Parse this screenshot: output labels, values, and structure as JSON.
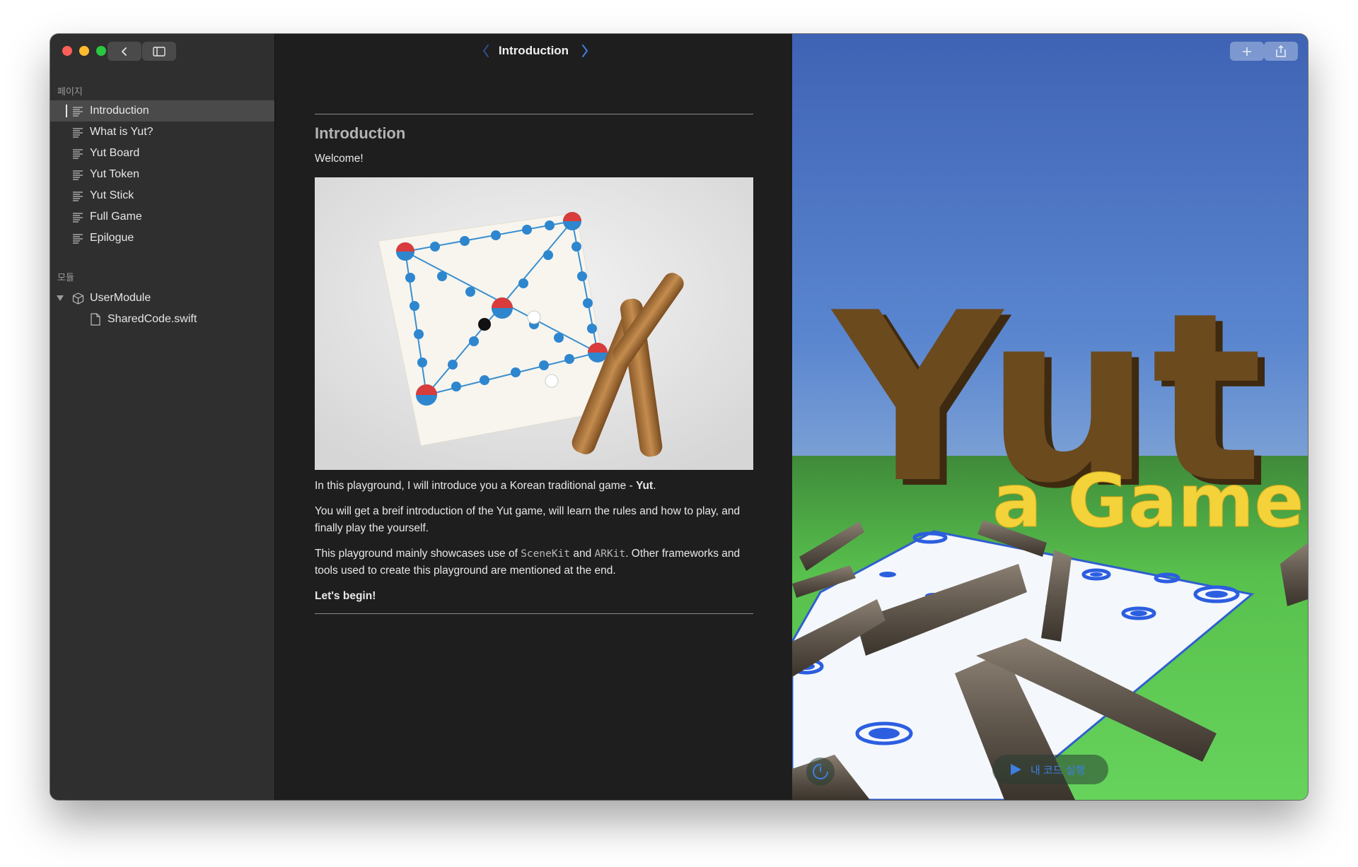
{
  "sidebar": {
    "pages_header": "페이지",
    "pages": [
      {
        "label": "Introduction",
        "selected": true
      },
      {
        "label": "What is Yut?"
      },
      {
        "label": "Yut Board"
      },
      {
        "label": "Yut Token"
      },
      {
        "label": "Yut Stick"
      },
      {
        "label": "Full Game"
      },
      {
        "label": "Epilogue"
      }
    ],
    "modules_header": "모듈",
    "module": {
      "label": "UserModule",
      "file": "SharedCode.swift"
    }
  },
  "content": {
    "header_title": "Introduction",
    "heading": "Introduction",
    "welcome": "Welcome!",
    "para1_prefix": "In this playground, I will introduce you a Korean traditional game - ",
    "para1_bold": "Yut",
    "para1_suffix": ".",
    "para2": "You will get a breif introduction of the Yut game, will learn the rules and how to play, and finally play the yourself.",
    "para3_a": "This playground mainly showcases use of ",
    "para3_code1": "SceneKit",
    "para3_b": " and ",
    "para3_code2": "ARKit",
    "para3_c": ". Other frameworks and tools used to create this playground are mentioned at the end.",
    "closing": "Let's begin!"
  },
  "liveview": {
    "title_big": "Yut",
    "title_sub": "a Game",
    "run_label": "내 코드 실행"
  },
  "colors": {
    "accent": "#3f7fe0",
    "sidebar_bg": "#2f2f2f",
    "content_bg": "#1e1e1e",
    "wood": "#6b4a1e",
    "title_yellow": "#f3d23a"
  }
}
